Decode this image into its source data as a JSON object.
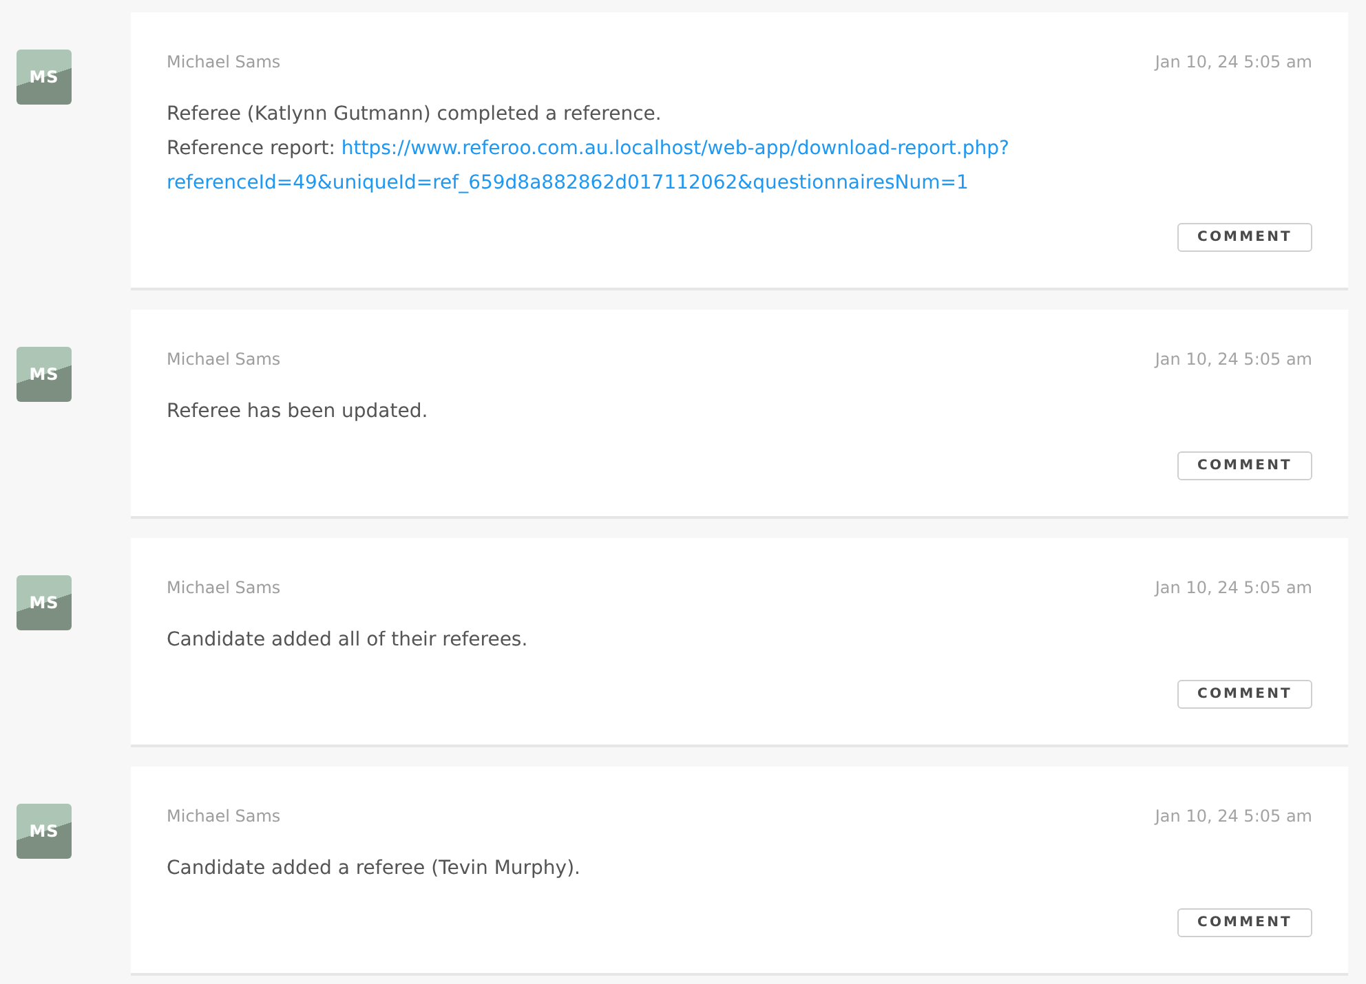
{
  "feed": [
    {
      "avatar": {
        "initials": "MS"
      },
      "author": "Michael Sams",
      "time": "Jan 10, 24 5:05 am",
      "message": "Referee (Katlynn Gutmann) completed a reference.",
      "report": {
        "label": "Reference report:",
        "link_lines": [
          "https://www.referoo.com.au.localhost/web-app/download-report.php?",
          "referenceId=49&uniqueId=ref_659d8a882862d017112062&questionnairesNum=1"
        ]
      },
      "comment_button": "COMMENT"
    },
    {
      "avatar": {
        "initials": "MS"
      },
      "author": "Michael Sams",
      "time": "Jan 10, 24 5:05 am",
      "message": "Referee has been updated.",
      "comment_button": "COMMENT"
    },
    {
      "avatar": {
        "initials": "MS"
      },
      "author": "Michael Sams",
      "time": "Jan 10, 24 5:05 am",
      "message": "Candidate added all of their referees.",
      "comment_button": "COMMENT"
    },
    {
      "avatar": {
        "initials": "MS"
      },
      "author": "Michael Sams",
      "time": "Jan 10, 24 5:05 am",
      "message": "Candidate added a referee (Tevin Murphy).",
      "comment_button": "COMMENT"
    }
  ]
}
